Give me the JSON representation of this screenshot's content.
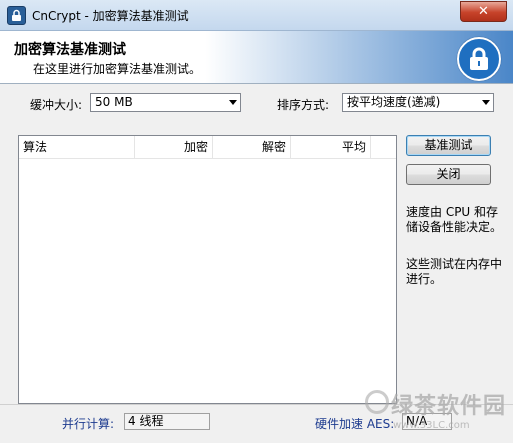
{
  "window": {
    "title": "CnCrypt - 加密算法基准测试",
    "close_label": "✕"
  },
  "banner": {
    "title": "加密算法基准测试",
    "subtitle": "在这里进行加密算法基准测试。",
    "icon": "lock-icon"
  },
  "options": {
    "buffer_label": "缓冲大小:",
    "buffer_value": "50 MB",
    "sort_label": "排序方式:",
    "sort_value": "按平均速度(递减)"
  },
  "table": {
    "columns": [
      "算法",
      "加密",
      "解密",
      "平均"
    ],
    "rows": []
  },
  "buttons": {
    "benchmark": "基准测试",
    "close": "关闭"
  },
  "info": {
    "speed_note": "速度由 CPU 和存储设备性能决定。",
    "memory_note": "这些测试在内存中进行。"
  },
  "status": {
    "parallel_label": "并行计算:",
    "parallel_value": "4 线程",
    "hw_aes_label": "硬件加速 AES:",
    "hw_aes_value": "N/A"
  },
  "watermark": {
    "name": "绿茶软件园",
    "url": "www.33LC.com"
  }
}
